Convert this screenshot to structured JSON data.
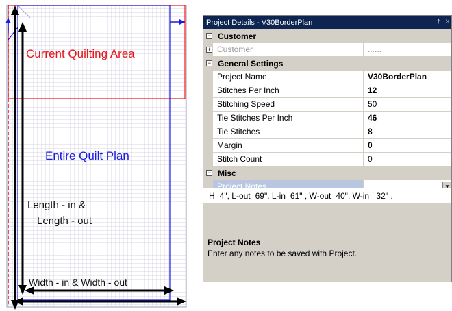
{
  "diagram": {
    "current_area_label": "Current Quilting Area",
    "entire_plan_label": "Entire Quilt Plan",
    "length_label_line1": "Length - in &",
    "length_label_line2": "Length - out",
    "width_label": "Width - in & Width - out",
    "colors": {
      "current_area": "#e8141c",
      "entire_plan": "#1a1ae0",
      "grid": "#c8c8d8"
    }
  },
  "panel": {
    "title": "Project Details - V30BorderPlan",
    "pin_glyph": "↑",
    "close_glyph": "×",
    "categories": {
      "customer": {
        "label": "Customer",
        "toggle": "−"
      },
      "general": {
        "label": "General Settings",
        "toggle": "−"
      },
      "misc": {
        "label": "Misc",
        "toggle": "−"
      }
    },
    "customer_row": {
      "name": "Customer",
      "value": "......",
      "toggle": "+"
    },
    "properties": [
      {
        "name": "Project Name",
        "value": "V30BorderPlan"
      },
      {
        "name": "Stitches Per Inch",
        "value": "12"
      },
      {
        "name": "Stitching Speed",
        "value": "50"
      },
      {
        "name": "Tie Stitches Per Inch",
        "value": "46"
      },
      {
        "name": "Tie Stitches",
        "value": "8"
      },
      {
        "name": "Margin",
        "value": "0"
      },
      {
        "name": "Stitch Count",
        "value": "0"
      }
    ],
    "notes_row": {
      "name": "Project Notes",
      "value": ""
    },
    "notes_text": "H=4\", L-out=69\". L-in=61\" , W-out=40\",  W-in= 32\"  .",
    "help": {
      "title": "Project Notes",
      "description": "Enter any notes to be saved with Project."
    }
  }
}
